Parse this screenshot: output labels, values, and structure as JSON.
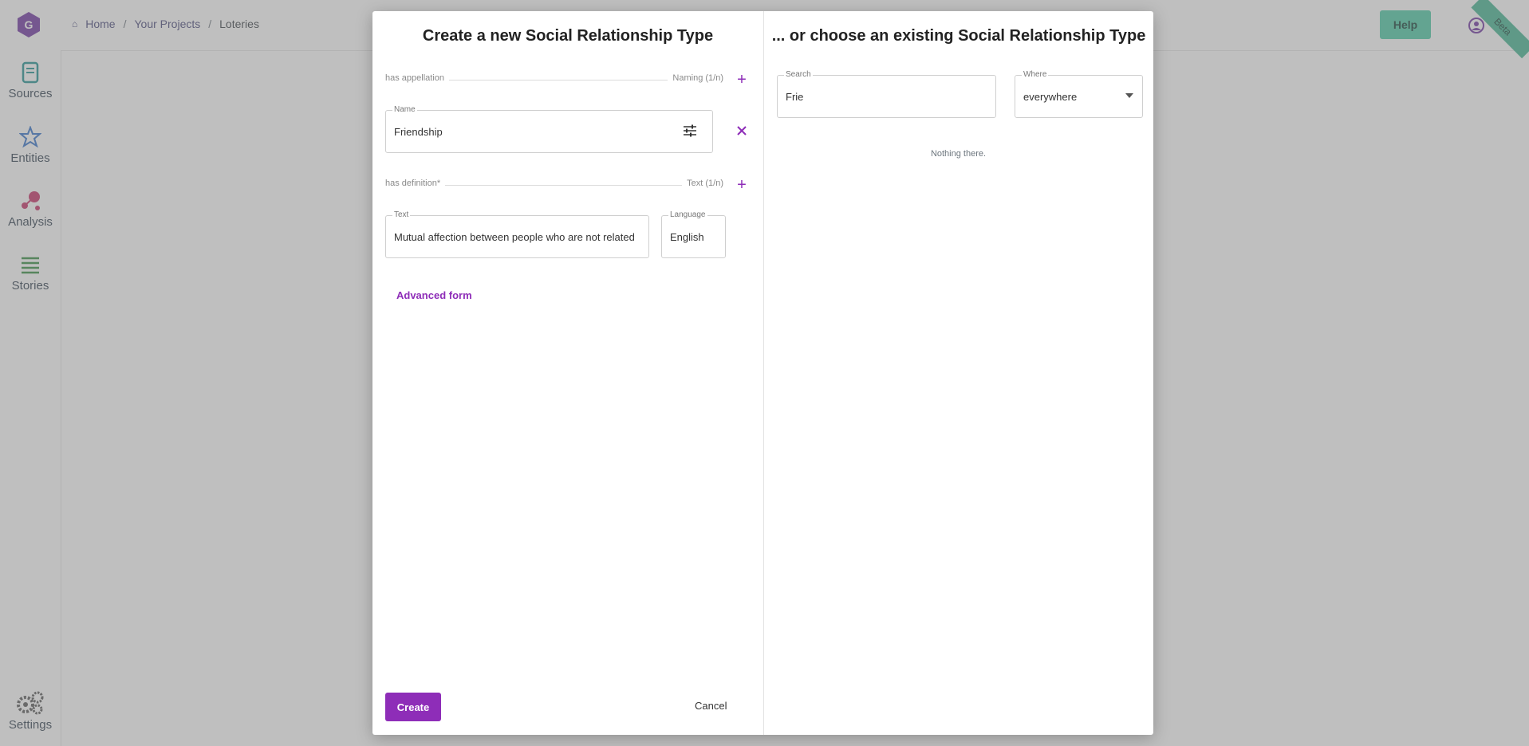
{
  "app": {
    "breadcrumb": [
      "Home",
      "Your Projects",
      "Loteries"
    ],
    "breadcrumb_sep": "/",
    "help_label": "Help",
    "beta_label": "Beta",
    "nav": [
      {
        "label": "Sources",
        "icon": "scroll-icon"
      },
      {
        "label": "Entities",
        "icon": "star-icon"
      },
      {
        "label": "Analysis",
        "icon": "molecule-icon"
      },
      {
        "label": "Stories",
        "icon": "lines-icon"
      },
      {
        "label": "Settings",
        "icon": "gears-icon"
      }
    ],
    "colors": {
      "accent": "#8e2db8",
      "help": "#46c9a3",
      "logo": "#6a2f9e"
    }
  },
  "modal": {
    "left_title": "Create a new Social Relationship Type",
    "right_title": "... or choose an existing Social Relationship Type",
    "appellation": {
      "label": "has appellation",
      "type": "Naming (1/n)"
    },
    "name_field": {
      "label": "Name",
      "value": "Friendship"
    },
    "definition": {
      "label": "has definition*",
      "type": "Text (1/n)"
    },
    "text_field": {
      "label": "Text",
      "value": "Mutual affection between people who are not related"
    },
    "language_field": {
      "label": "Language",
      "value": "English"
    },
    "advanced_form": "Advanced form",
    "create_label": "Create",
    "cancel_label": "Cancel",
    "search": {
      "label": "Search",
      "value": "Frie"
    },
    "where": {
      "label": "Where",
      "value": "everywhere"
    },
    "empty_message": "Nothing there."
  }
}
